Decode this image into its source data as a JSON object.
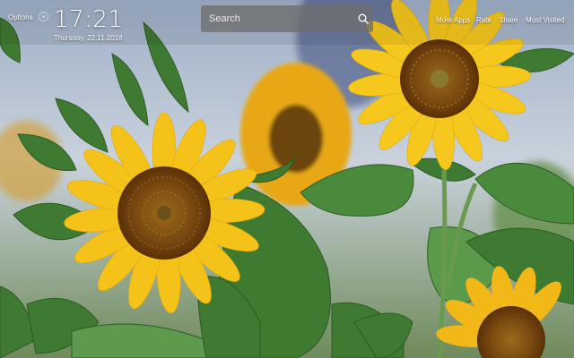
{
  "header": {
    "options_label": "Options",
    "time": "17:21",
    "date": "Thursday, 22.11.2018"
  },
  "search": {
    "placeholder": "Search",
    "icon": "search-icon"
  },
  "nav": {
    "more_apps": "More Apps",
    "rate": "Rate",
    "share": "Share",
    "most_visited": "Most Visited"
  },
  "colors": {
    "sky": "#b8c4d8",
    "petal": "#f5c518",
    "center": "#7a4a0e",
    "leaf": "#4e8a3a"
  }
}
